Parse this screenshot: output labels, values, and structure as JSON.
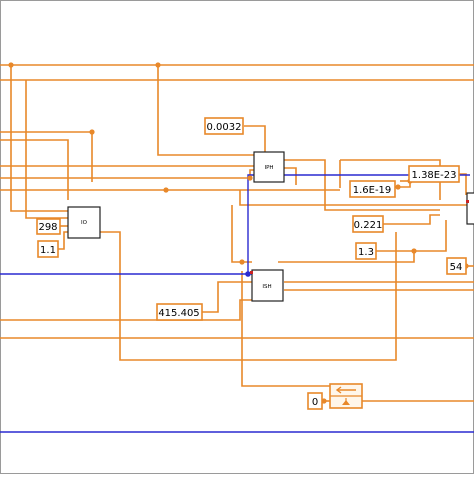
{
  "colors": {
    "background": "#ffffff",
    "frame": "#9a9a9a",
    "wire_numeric": "#e8882a",
    "wire_signal": "#2a2ad0",
    "terminal_fill": "#ffffff",
    "node_border": "#222222"
  },
  "constants": {
    "c_0032": "0.0032",
    "c_138e23": "1.38E-23",
    "c_16e19": "1.6E-19",
    "c_298": "298",
    "c_0221": "0.221",
    "c_11": "1.1",
    "c_13": "1.3",
    "c_54": "54",
    "c_415405": "415.405",
    "c_0": "0"
  },
  "nodes": {
    "iph": "IPH",
    "io": "IO",
    "ish": "ISH"
  }
}
